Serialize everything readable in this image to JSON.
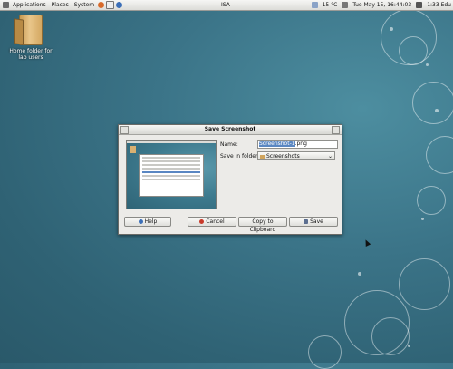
{
  "panel": {
    "menus": [
      "Applications",
      "Places",
      "System"
    ],
    "center_text": "ISA",
    "temperature": "15 °C",
    "datetime": "Tue May 15, 16:44:03",
    "status_right": "1:33 Edu"
  },
  "desktop": {
    "icon_label_line1": "Home folder for",
    "icon_label_line2": "lab users"
  },
  "dialog": {
    "title": "Save Screenshot",
    "name_label": "Name:",
    "name_selected": "Screenshot-1",
    "name_ext": ".png",
    "folder_label": "Save in folder:",
    "folder_value": "Screenshots",
    "help_label": "Help",
    "cancel_label": "Cancel",
    "copy_label": "Copy to Clipboard",
    "save_label": "Save"
  },
  "icons": {
    "panel": [
      "foot-icon",
      "firefox-icon",
      "mail-icon",
      "help-icon"
    ],
    "tray": [
      "weather-icon",
      "network-icon",
      "volume-icon"
    ]
  }
}
